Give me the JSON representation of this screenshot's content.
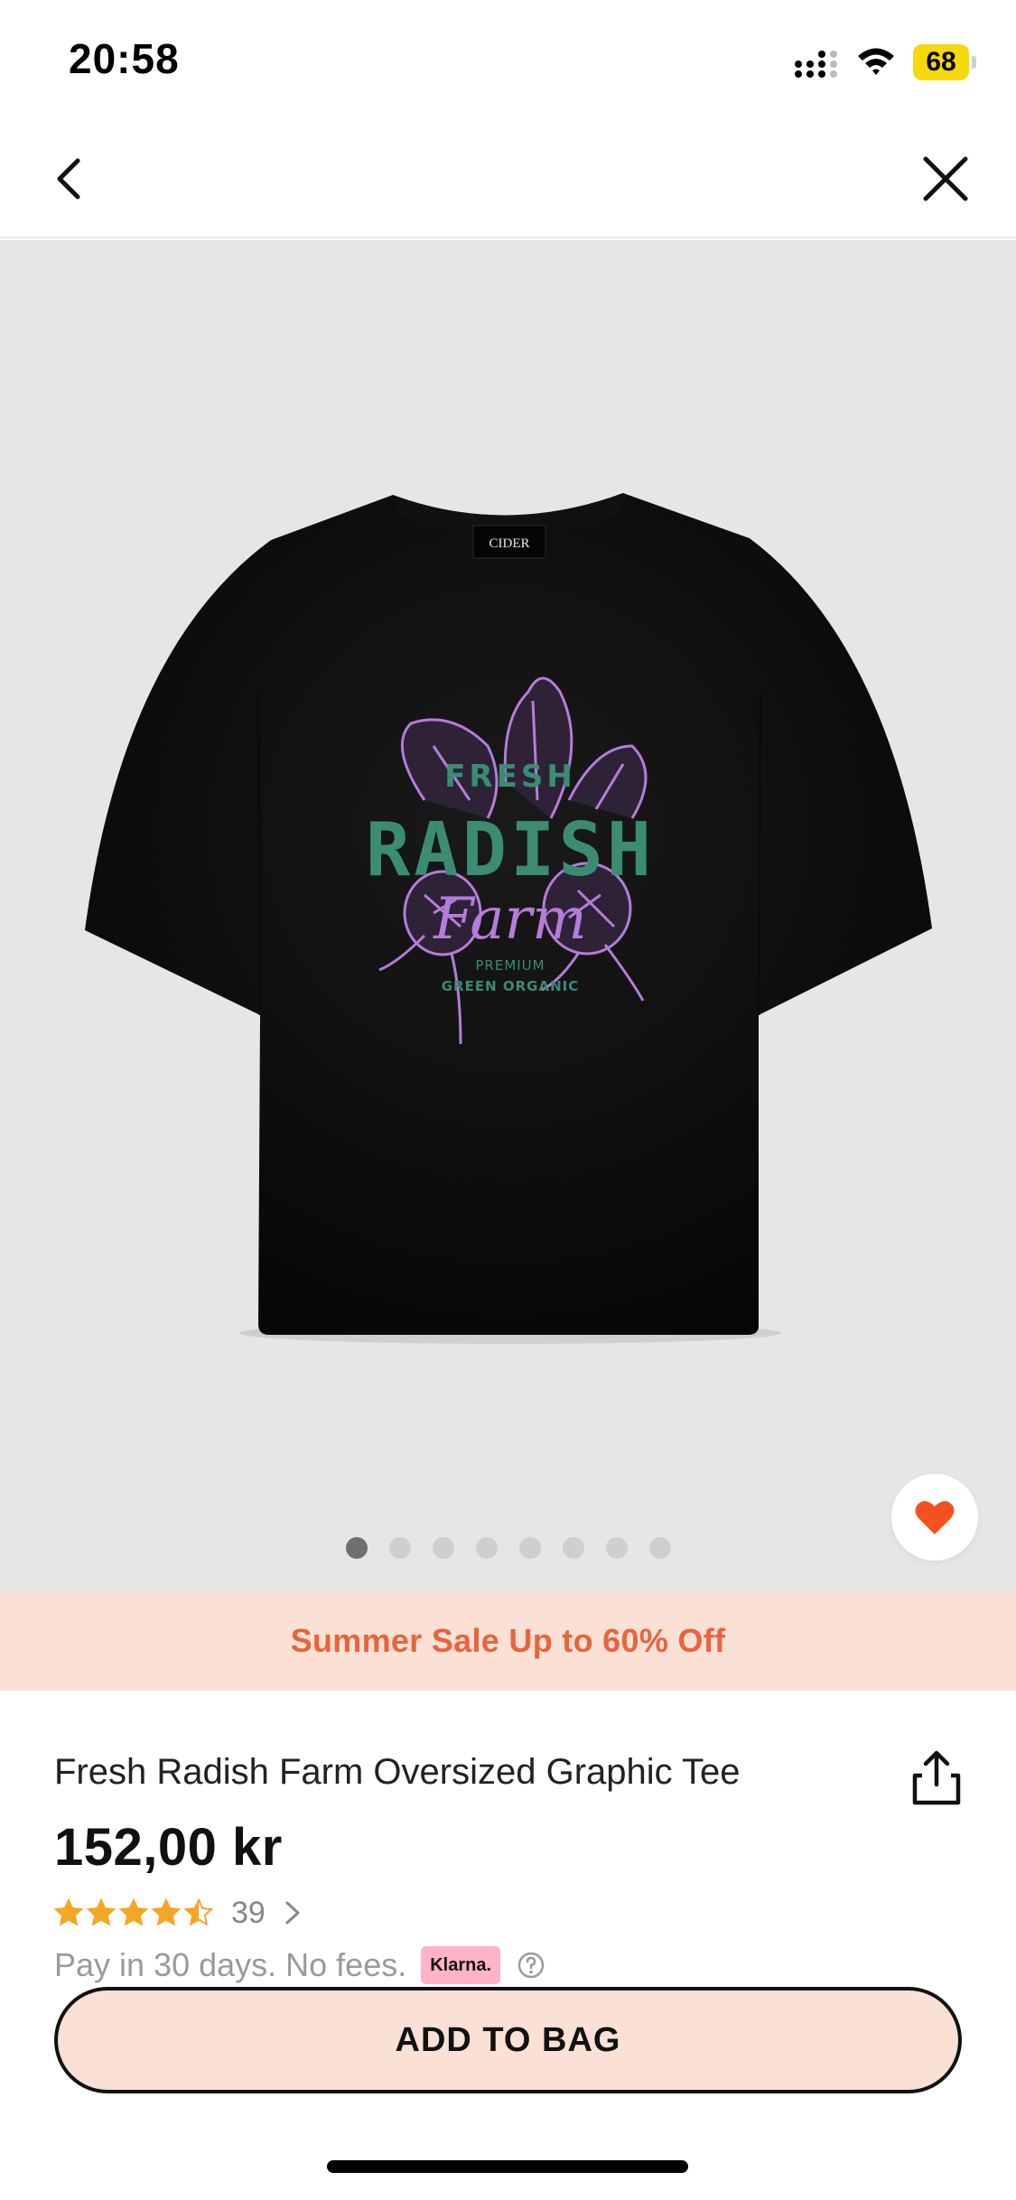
{
  "status_bar": {
    "time": "20:58",
    "battery": "68"
  },
  "nav": {
    "back_icon": "chevron-left-icon",
    "close_icon": "close-icon"
  },
  "gallery": {
    "image_count": 8,
    "active_index": 0,
    "tee_brand_label": "CIDER",
    "graphic": {
      "line1": "FRESH",
      "line2": "RADISH",
      "line3": "Farm",
      "line4": "PREMIUM",
      "line5": "GREEN ORGANIC"
    },
    "wishlist_icon": "heart-icon"
  },
  "promo": {
    "text": "Summer Sale Up to 60% Off"
  },
  "product": {
    "title": "Fresh Radish Farm Oversized Graphic Tee",
    "price": "152,00 kr",
    "rating": 4.5,
    "review_count": "39",
    "pay_text": "Pay in 30 days. No fees.",
    "klarna_label": "Klarna."
  },
  "actions": {
    "add_to_bag": "ADD TO BAG"
  },
  "colors": {
    "accent": "#e8643b",
    "promo_bg": "#fbe0d6",
    "gallery_bg": "#e6e6e6",
    "heart": "#f4511e",
    "star": "#f5a623",
    "klarna": "#ffb3c7"
  }
}
